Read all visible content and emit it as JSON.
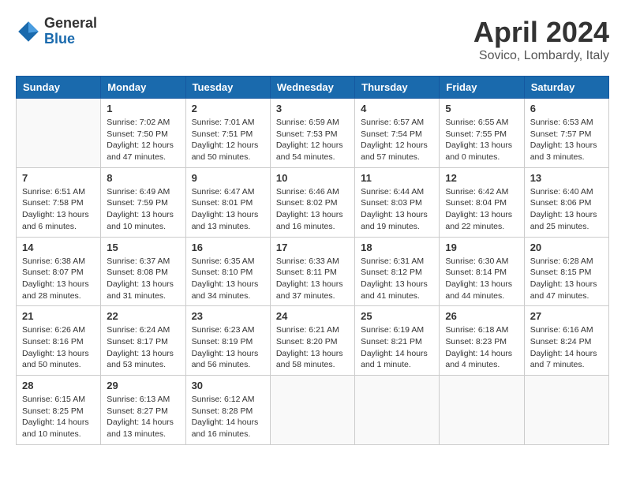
{
  "logo": {
    "general": "General",
    "blue": "Blue"
  },
  "title": "April 2024",
  "subtitle": "Sovico, Lombardy, Italy",
  "header_days": [
    "Sunday",
    "Monday",
    "Tuesday",
    "Wednesday",
    "Thursday",
    "Friday",
    "Saturday"
  ],
  "weeks": [
    [
      {
        "day": "",
        "info": ""
      },
      {
        "day": "1",
        "info": "Sunrise: 7:02 AM\nSunset: 7:50 PM\nDaylight: 12 hours\nand 47 minutes."
      },
      {
        "day": "2",
        "info": "Sunrise: 7:01 AM\nSunset: 7:51 PM\nDaylight: 12 hours\nand 50 minutes."
      },
      {
        "day": "3",
        "info": "Sunrise: 6:59 AM\nSunset: 7:53 PM\nDaylight: 12 hours\nand 54 minutes."
      },
      {
        "day": "4",
        "info": "Sunrise: 6:57 AM\nSunset: 7:54 PM\nDaylight: 12 hours\nand 57 minutes."
      },
      {
        "day": "5",
        "info": "Sunrise: 6:55 AM\nSunset: 7:55 PM\nDaylight: 13 hours\nand 0 minutes."
      },
      {
        "day": "6",
        "info": "Sunrise: 6:53 AM\nSunset: 7:57 PM\nDaylight: 13 hours\nand 3 minutes."
      }
    ],
    [
      {
        "day": "7",
        "info": "Sunrise: 6:51 AM\nSunset: 7:58 PM\nDaylight: 13 hours\nand 6 minutes."
      },
      {
        "day": "8",
        "info": "Sunrise: 6:49 AM\nSunset: 7:59 PM\nDaylight: 13 hours\nand 10 minutes."
      },
      {
        "day": "9",
        "info": "Sunrise: 6:47 AM\nSunset: 8:01 PM\nDaylight: 13 hours\nand 13 minutes."
      },
      {
        "day": "10",
        "info": "Sunrise: 6:46 AM\nSunset: 8:02 PM\nDaylight: 13 hours\nand 16 minutes."
      },
      {
        "day": "11",
        "info": "Sunrise: 6:44 AM\nSunset: 8:03 PM\nDaylight: 13 hours\nand 19 minutes."
      },
      {
        "day": "12",
        "info": "Sunrise: 6:42 AM\nSunset: 8:04 PM\nDaylight: 13 hours\nand 22 minutes."
      },
      {
        "day": "13",
        "info": "Sunrise: 6:40 AM\nSunset: 8:06 PM\nDaylight: 13 hours\nand 25 minutes."
      }
    ],
    [
      {
        "day": "14",
        "info": "Sunrise: 6:38 AM\nSunset: 8:07 PM\nDaylight: 13 hours\nand 28 minutes."
      },
      {
        "day": "15",
        "info": "Sunrise: 6:37 AM\nSunset: 8:08 PM\nDaylight: 13 hours\nand 31 minutes."
      },
      {
        "day": "16",
        "info": "Sunrise: 6:35 AM\nSunset: 8:10 PM\nDaylight: 13 hours\nand 34 minutes."
      },
      {
        "day": "17",
        "info": "Sunrise: 6:33 AM\nSunset: 8:11 PM\nDaylight: 13 hours\nand 37 minutes."
      },
      {
        "day": "18",
        "info": "Sunrise: 6:31 AM\nSunset: 8:12 PM\nDaylight: 13 hours\nand 41 minutes."
      },
      {
        "day": "19",
        "info": "Sunrise: 6:30 AM\nSunset: 8:14 PM\nDaylight: 13 hours\nand 44 minutes."
      },
      {
        "day": "20",
        "info": "Sunrise: 6:28 AM\nSunset: 8:15 PM\nDaylight: 13 hours\nand 47 minutes."
      }
    ],
    [
      {
        "day": "21",
        "info": "Sunrise: 6:26 AM\nSunset: 8:16 PM\nDaylight: 13 hours\nand 50 minutes."
      },
      {
        "day": "22",
        "info": "Sunrise: 6:24 AM\nSunset: 8:17 PM\nDaylight: 13 hours\nand 53 minutes."
      },
      {
        "day": "23",
        "info": "Sunrise: 6:23 AM\nSunset: 8:19 PM\nDaylight: 13 hours\nand 56 minutes."
      },
      {
        "day": "24",
        "info": "Sunrise: 6:21 AM\nSunset: 8:20 PM\nDaylight: 13 hours\nand 58 minutes."
      },
      {
        "day": "25",
        "info": "Sunrise: 6:19 AM\nSunset: 8:21 PM\nDaylight: 14 hours\nand 1 minute."
      },
      {
        "day": "26",
        "info": "Sunrise: 6:18 AM\nSunset: 8:23 PM\nDaylight: 14 hours\nand 4 minutes."
      },
      {
        "day": "27",
        "info": "Sunrise: 6:16 AM\nSunset: 8:24 PM\nDaylight: 14 hours\nand 7 minutes."
      }
    ],
    [
      {
        "day": "28",
        "info": "Sunrise: 6:15 AM\nSunset: 8:25 PM\nDaylight: 14 hours\nand 10 minutes."
      },
      {
        "day": "29",
        "info": "Sunrise: 6:13 AM\nSunset: 8:27 PM\nDaylight: 14 hours\nand 13 minutes."
      },
      {
        "day": "30",
        "info": "Sunrise: 6:12 AM\nSunset: 8:28 PM\nDaylight: 14 hours\nand 16 minutes."
      },
      {
        "day": "",
        "info": ""
      },
      {
        "day": "",
        "info": ""
      },
      {
        "day": "",
        "info": ""
      },
      {
        "day": "",
        "info": ""
      }
    ]
  ]
}
